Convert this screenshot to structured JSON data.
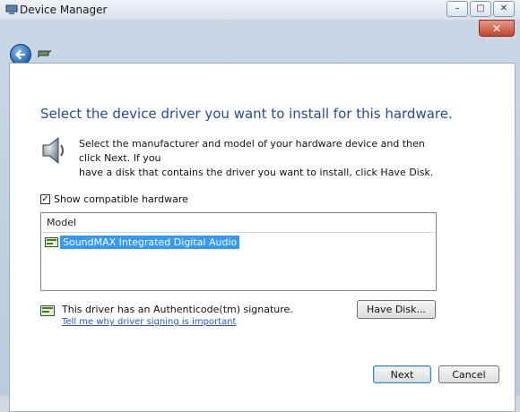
{
  "window": {
    "title": "Device Manager",
    "controls": [
      "minimize",
      "maximize",
      "close"
    ],
    "minimize_glyph": "–",
    "maximize_glyph": "□",
    "close_glyph": "✕"
  },
  "wizard": {
    "close_glyph": "✕",
    "heading": "Select the device driver you want to install for this hardware.",
    "instructions_line1": "Select the manufacturer and model of your hardware device and then click Next. If you",
    "instructions_line2": "have a disk that contains the driver you want to install, click Have Disk.",
    "show_compatible": {
      "label": "Show compatible hardware",
      "checked": true,
      "check_glyph": "✓"
    },
    "model_list": {
      "header": "Model",
      "items": [
        {
          "label": "SoundMAX Integrated Digital Audio",
          "selected": true,
          "icon": "driver-icon"
        }
      ]
    },
    "signature": {
      "text": "This driver has an Authenticode(tm) signature.",
      "link": "Tell me why driver signing is important",
      "icon": "certificate-icon"
    },
    "have_disk_label": "Have Disk...",
    "next_label": "Next",
    "cancel_label": "Cancel"
  },
  "colors": {
    "heading": "#1f4e96",
    "selection": "#3399ff",
    "link": "#2255cc",
    "close_button": "#c3452d"
  }
}
